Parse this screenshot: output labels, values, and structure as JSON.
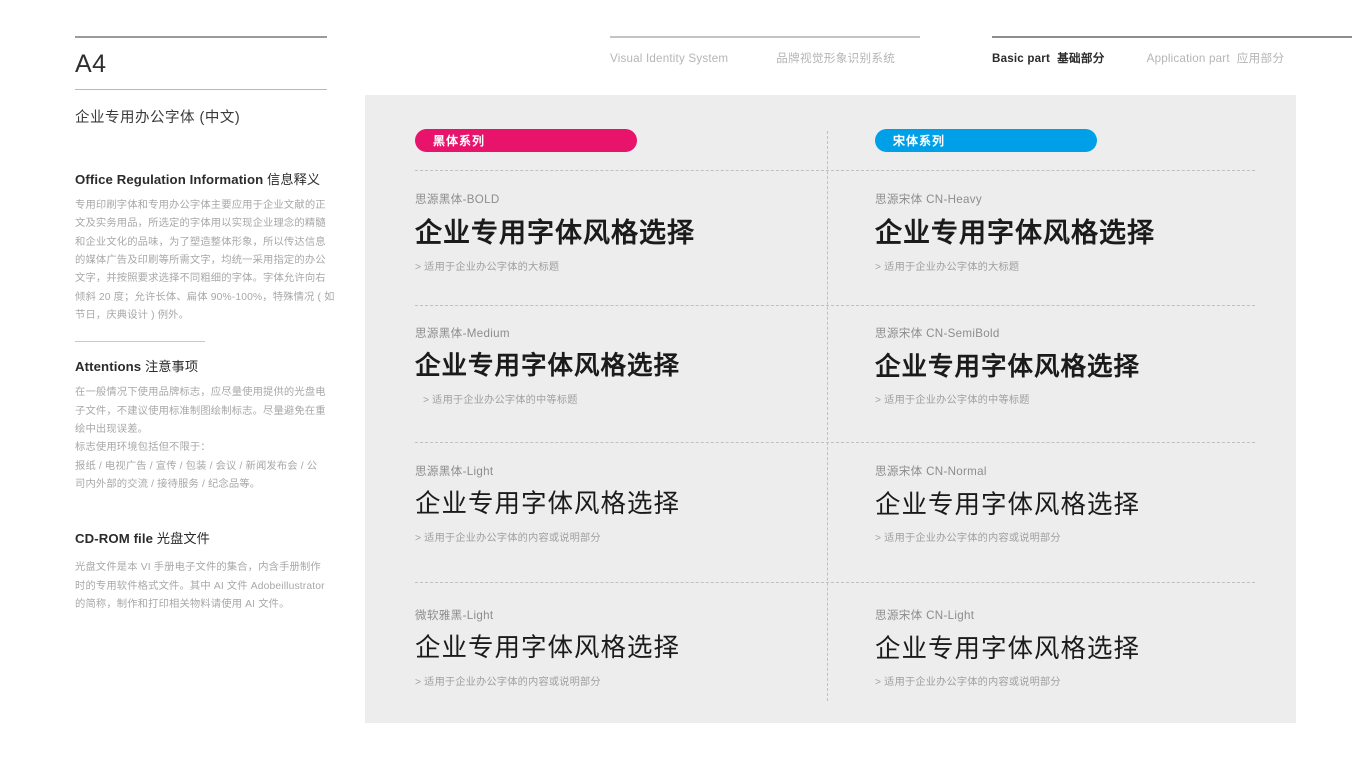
{
  "sidebar": {
    "page_label": "A4",
    "subtitle": "企业专用办公字体 (中文)",
    "sections": [
      {
        "heading_en": "Office Regulation Information",
        "heading_cn": "信息释义",
        "lines": [
          "专用印刷字体和专用办公字体主要应用于企业文献的正",
          "文及实务用品，所选定的字体用以实现企业理念的精髓",
          "和企业文化的品味，为了塑造整体形象，所以传达信息",
          "的媒体广告及印刷等所需文字，均统一采用指定的办公",
          "文字，并按照要求选择不同粗细的字体。字体允许向右",
          "倾斜 20 度；允许长体、扁体 90%-100%，特殊情况 ( 如",
          "节日，庆典设计 ) 例外。"
        ]
      },
      {
        "heading_en": "Attentions",
        "heading_cn": "注意事项",
        "lines": [
          "在一般情况下使用品牌标志，应尽量使用提供的光盘电",
          "子文件，不建议使用标准制图绘制标志。尽量避免在重",
          "绘中出现误差。",
          "标志使用环境包括但不限于：",
          "报纸 / 电视广告 / 宣传 / 包装 / 会议 / 新闻发布会 / 公",
          "司内外部的交流 / 接待服务 / 纪念品等。"
        ]
      },
      {
        "heading_en": "CD-ROM file",
        "heading_cn": "光盘文件",
        "lines": [
          "光盘文件是本 VI 手册电子文件的集合，内含手册制作",
          "时的专用软件格式文件。其中 AI 文件 Adobeillustrator",
          "的简称，制作和打印相关物料请使用 AI 文件。"
        ]
      }
    ]
  },
  "header": {
    "left": {
      "en": "Visual Identity System",
      "cn": "品牌视觉形象识别系统"
    },
    "nav": [
      {
        "en": "Basic part",
        "cn": "基础部分",
        "active": true
      },
      {
        "en": "Application part",
        "cn": "应用部分",
        "active": false
      }
    ]
  },
  "colors": {
    "badge_hei": "#e8136b",
    "badge_song": "#00a0e9",
    "panel_bg": "#ededed",
    "page_bg": "#ffffff"
  },
  "panel": {
    "badges": {
      "hei": "黑体系列",
      "song": "宋体系列"
    },
    "columns": [
      {
        "key": "hei",
        "rows": [
          {
            "font_name": "思源黑体-BOLD",
            "sample": "企业专用字体风格选择",
            "note": "> 适用于企业办公字体的大标题"
          },
          {
            "font_name": "思源黑体-Medium",
            "sample": "企业专用字体风格选择",
            "note": "> 适用于企业办公字体的中等标题"
          },
          {
            "font_name": "思源黑体-Light",
            "sample": "企业专用字体风格选择",
            "note": "> 适用于企业办公字体的内容或说明部分"
          },
          {
            "font_name": "微软雅黑-Light",
            "sample": "企业专用字体风格选择",
            "note": "> 适用于企业办公字体的内容或说明部分"
          }
        ]
      },
      {
        "key": "song",
        "rows": [
          {
            "font_name": "思源宋体 CN-Heavy",
            "sample": "企业专用字体风格选择",
            "note": "> 适用于企业办公字体的大标题"
          },
          {
            "font_name": "思源宋体 CN-SemiBold",
            "sample": "企业专用字体风格选择",
            "note": "> 适用于企业办公字体的中等标题"
          },
          {
            "font_name": "思源宋体 CN-Normal",
            "sample": "企业专用字体风格选择",
            "note": "> 适用于企业办公字体的内容或说明部分"
          },
          {
            "font_name": "思源宋体 CN-Light",
            "sample": "企业专用字体风格选择",
            "note": "> 适用于企业办公字体的内容或说明部分"
          }
        ]
      }
    ]
  }
}
